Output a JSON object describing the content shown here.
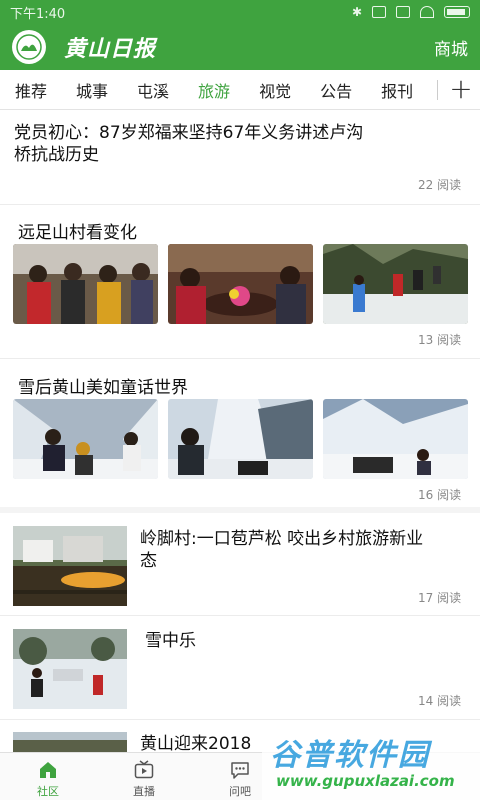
{
  "status_bar": {
    "time": "下午1:40"
  },
  "header": {
    "title": "黄山日报",
    "mall_label": "商城"
  },
  "tabs": [
    {
      "label": "推荐"
    },
    {
      "label": "城事"
    },
    {
      "label": "屯溪"
    },
    {
      "label": "旅游",
      "active": true
    },
    {
      "label": "视觉"
    },
    {
      "label": "公告"
    },
    {
      "label": "报刊"
    }
  ],
  "articles": [
    {
      "title": "党员初心：87岁郑福来坚持67年义务讲述卢沟桥抗战历史",
      "reads": "22 阅读"
    },
    {
      "title": "远足山村看变化",
      "reads": "13 阅读"
    },
    {
      "title": "雪后黄山美如童话世界",
      "reads": "16 阅读"
    },
    {
      "title": "岭脚村:一口苞芦松 咬出乡村旅游新业态",
      "reads": "17 阅读"
    },
    {
      "title": "雪中乐",
      "reads": "14 阅读"
    },
    {
      "title": "黄山迎来2018"
    }
  ],
  "bottom_nav": [
    {
      "label": "社区",
      "icon": "home-icon",
      "active": true
    },
    {
      "label": "直播",
      "icon": "tv-icon"
    },
    {
      "label": "问吧",
      "icon": "chat-bubble-icon"
    }
  ],
  "watermark": {
    "main": "谷普软件园",
    "url": "www.gupuxlazai.com"
  },
  "colors": {
    "brand_green": "#3fa33f",
    "text": "#111111",
    "meta_gray": "#888888"
  }
}
